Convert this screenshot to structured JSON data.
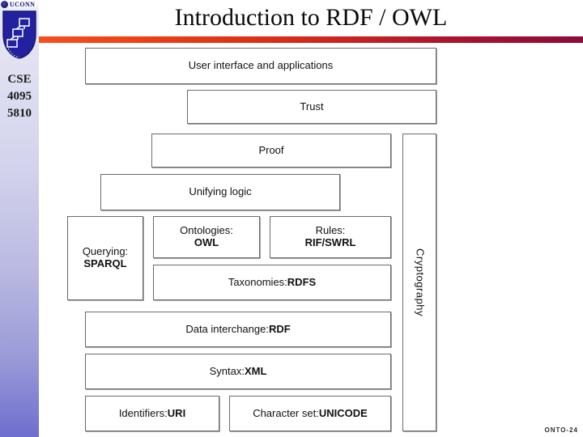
{
  "slide": {
    "title": "Introduction to RDF / OWL",
    "footer_code": "ONTO-24"
  },
  "sidebar": {
    "logo_word": "UCONN",
    "course": {
      "dept": "CSE",
      "number_1": "4095",
      "number_2": "5810"
    }
  },
  "colors": {
    "rule_start": "#f4511e",
    "rule_end": "#8e0b38",
    "sidebar_top": "#e8e8f6",
    "sidebar_bottom": "#6e6ece",
    "logo_blue": "#1a1a6e",
    "box_border": "#6b6b6b"
  },
  "diagram": {
    "name": "Semantic Web Stack",
    "layers": [
      {
        "id": "user-interface",
        "text": "User interface and applications",
        "bold_text": ""
      },
      {
        "id": "trust",
        "text": "Trust",
        "bold_text": ""
      },
      {
        "id": "proof",
        "text": "Proof",
        "bold_text": ""
      },
      {
        "id": "unifying-logic",
        "text": "Unifying logic",
        "bold_text": ""
      },
      {
        "id": "querying",
        "text": "Querying:",
        "bold_text": "SPARQL"
      },
      {
        "id": "ontologies",
        "text": "Ontologies:",
        "bold_text": "OWL"
      },
      {
        "id": "rules",
        "text": "Rules:",
        "bold_text": "RIF/SWRL"
      },
      {
        "id": "taxonomies",
        "text": "Taxonomies: ",
        "bold_text": "RDFS"
      },
      {
        "id": "data-interchange",
        "text": "Data interchange: ",
        "bold_text": "RDF"
      },
      {
        "id": "syntax",
        "text": "Syntax: ",
        "bold_text": "XML"
      },
      {
        "id": "identifiers",
        "text": "Identifiers: ",
        "bold_text": "URI"
      },
      {
        "id": "character-set",
        "text": "Character set: ",
        "bold_text": "UNICODE"
      },
      {
        "id": "cryptography",
        "text": "Cryptography",
        "bold_text": ""
      }
    ]
  }
}
